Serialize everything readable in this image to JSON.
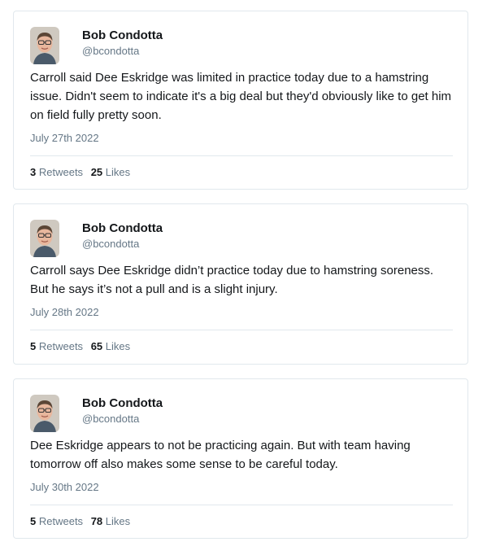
{
  "tweets": [
    {
      "name": "Bob Condotta",
      "handle": "@bcondotta",
      "text": "Carroll said Dee Eskridge was limited in practice today due to a hamstring issue. Didn't seem to indicate it's a big deal but they'd obviously like to get him on field fully pretty soon.",
      "date": "July 27th 2022",
      "retweets": "3",
      "retweets_label": "Retweets",
      "likes": "25",
      "likes_label": "Likes"
    },
    {
      "name": "Bob Condotta",
      "handle": "@bcondotta",
      "text": "Carroll says Dee Eskridge didn’t practice today due to hamstring soreness. But he says it’s not a pull and is a slight injury.",
      "date": "July 28th 2022",
      "retweets": "5",
      "retweets_label": "Retweets",
      "likes": "65",
      "likes_label": "Likes"
    },
    {
      "name": "Bob Condotta",
      "handle": "@bcondotta",
      "text": "Dee Eskridge appears to not be practicing again. But with team having tomorrow off also makes some sense to be careful today.",
      "date": "July 30th 2022",
      "retweets": "5",
      "retweets_label": "Retweets",
      "likes": "78",
      "likes_label": "Likes"
    }
  ]
}
